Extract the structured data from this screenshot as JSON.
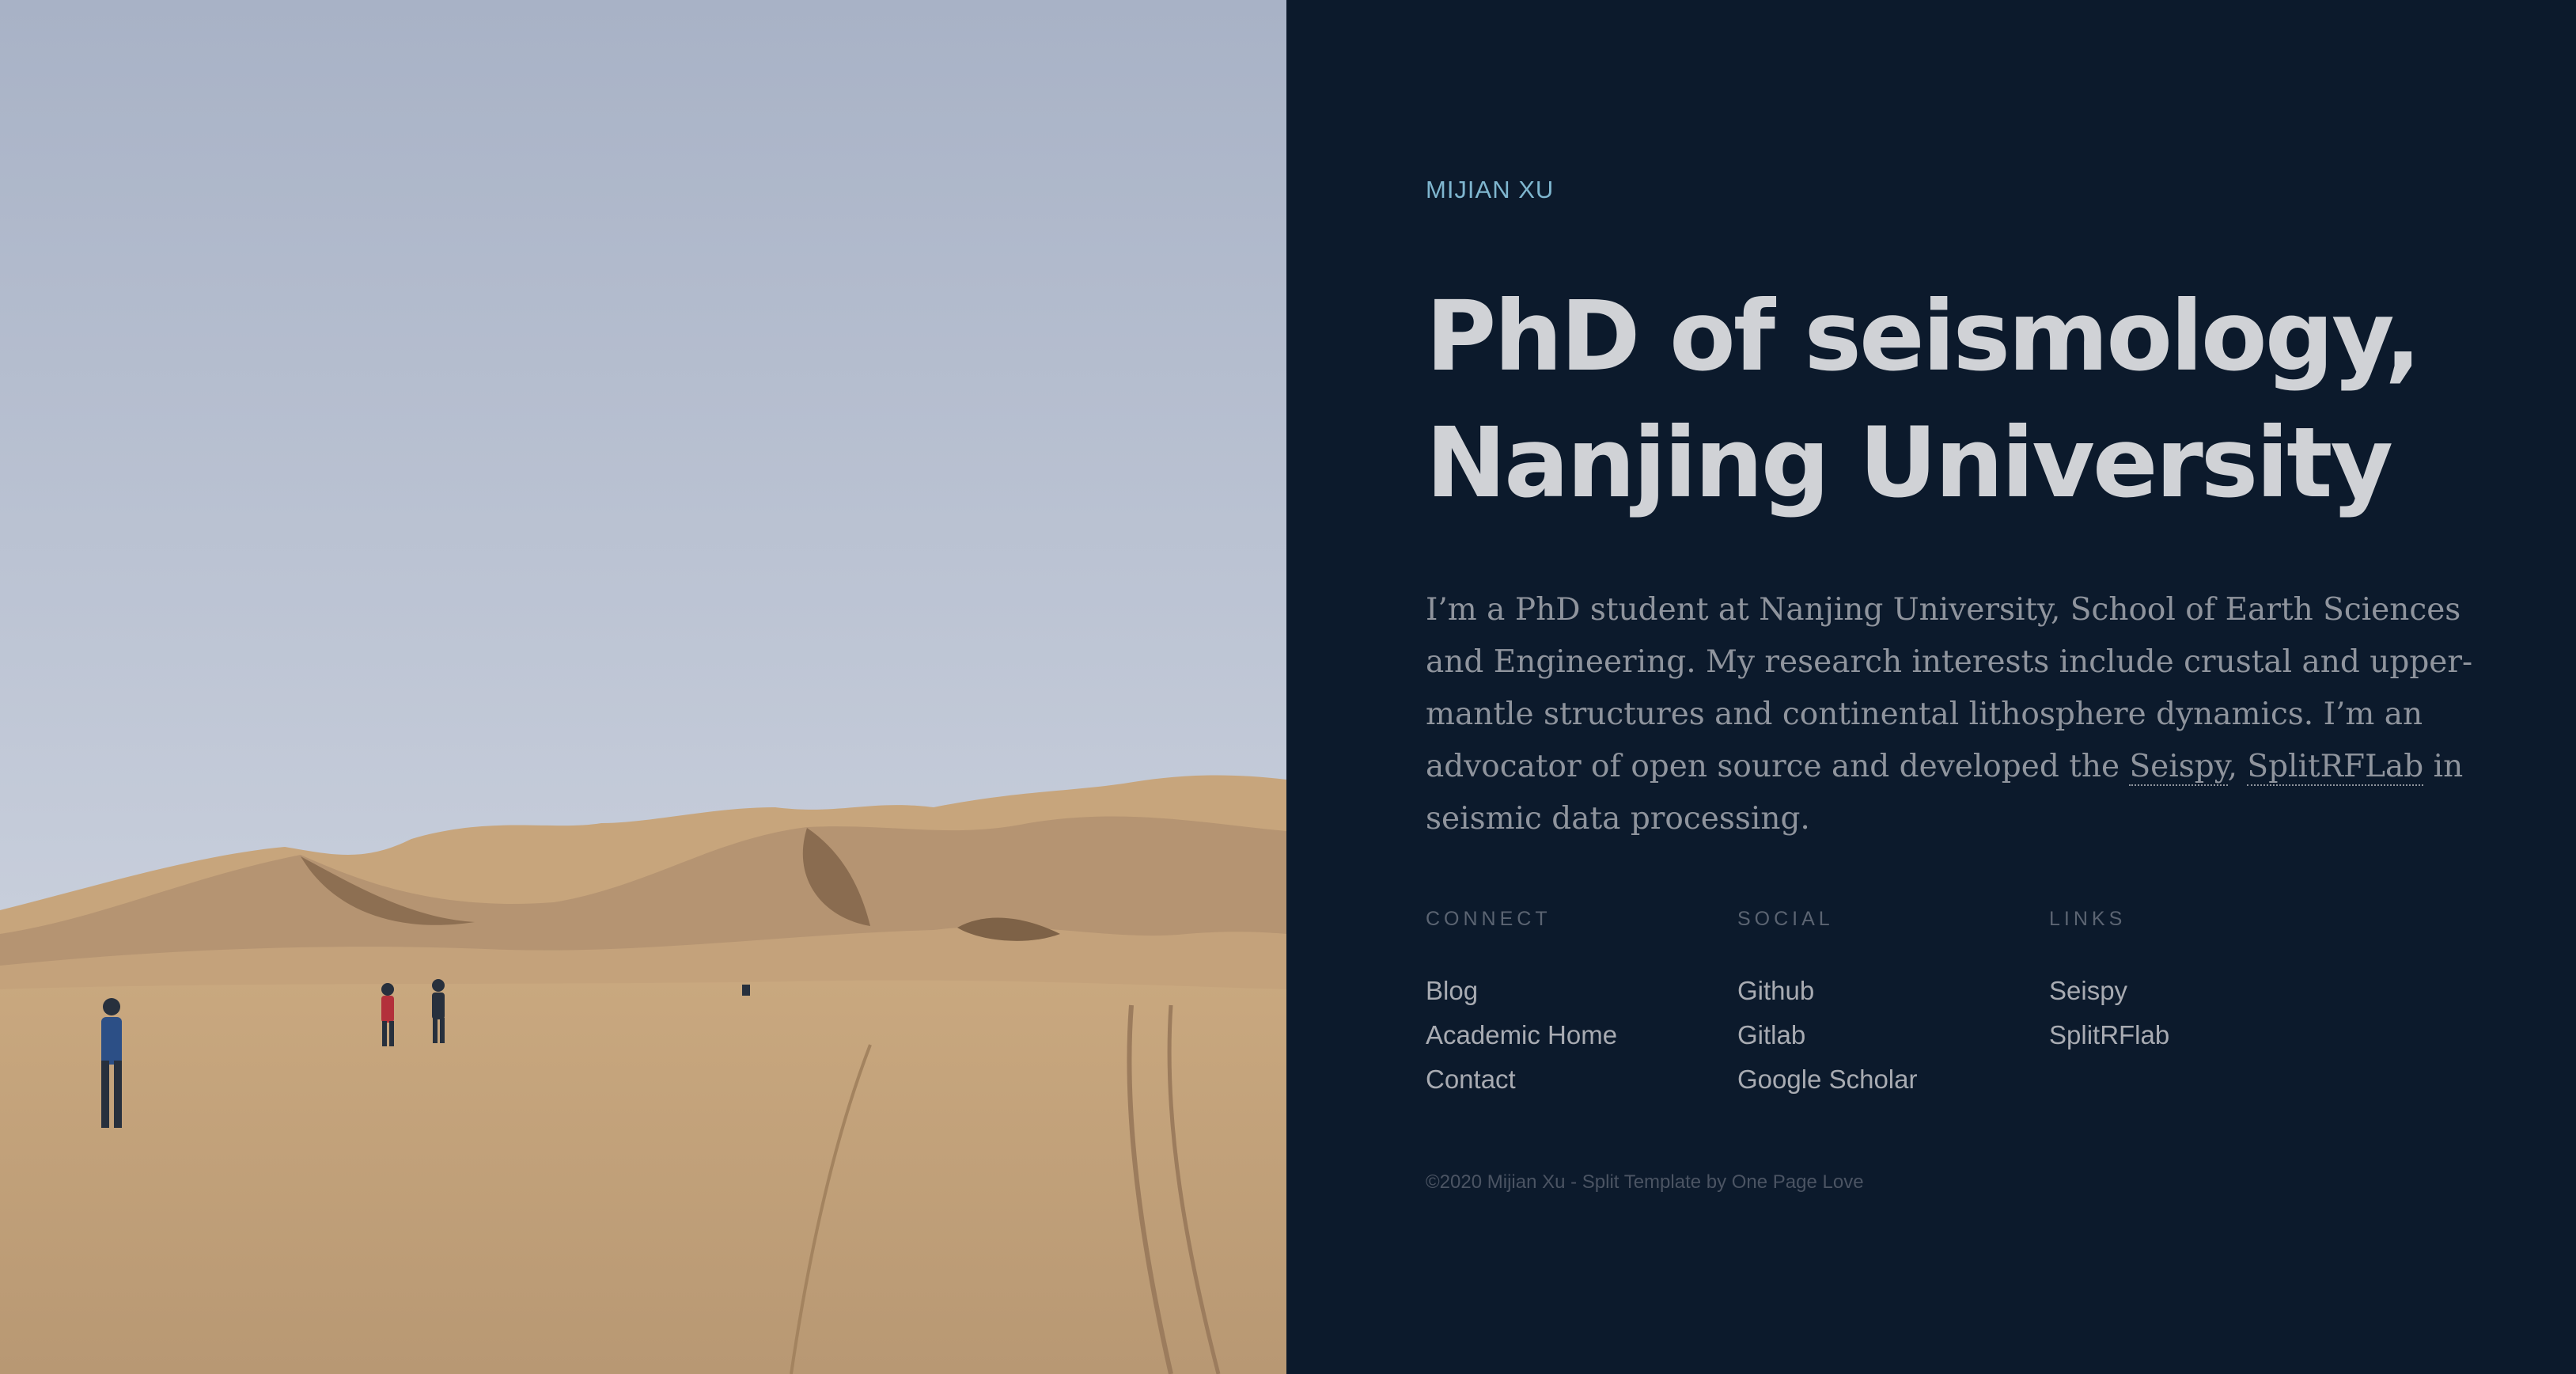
{
  "site": {
    "name": "MIJIAN XU",
    "headline_line1": "PhD of seismology,",
    "headline_line2": "Nanjing University",
    "intro": {
      "text_before": "I’m a PhD student at Nanjing University, School of Earth Sciences and Engineering. My research interests include crustal and upper-mantle structures and continental lithosphere dynamics. I’m an advocator of open source and developed the ",
      "link1": "Seispy",
      "separator": ", ",
      "link2": "SplitRFLab",
      "text_after": " in seismic data processing."
    }
  },
  "columns": {
    "connect": {
      "title": "CONNECT",
      "items": [
        "Blog",
        "Academic Home",
        "Contact"
      ]
    },
    "social": {
      "title": "SOCIAL",
      "items": [
        "Github",
        "Gitlab",
        "Google Scholar"
      ]
    },
    "links": {
      "title": "LINKS",
      "items": [
        "Seispy",
        "SplitRFlab"
      ]
    }
  },
  "footer": {
    "text": "©2020 Mijian Xu - Split Template by One Page Love"
  },
  "colors": {
    "background": "#0c1a2c",
    "accent": "#7fb6cf",
    "headline": "#d0d2d6",
    "body_text": "#8f949d"
  }
}
